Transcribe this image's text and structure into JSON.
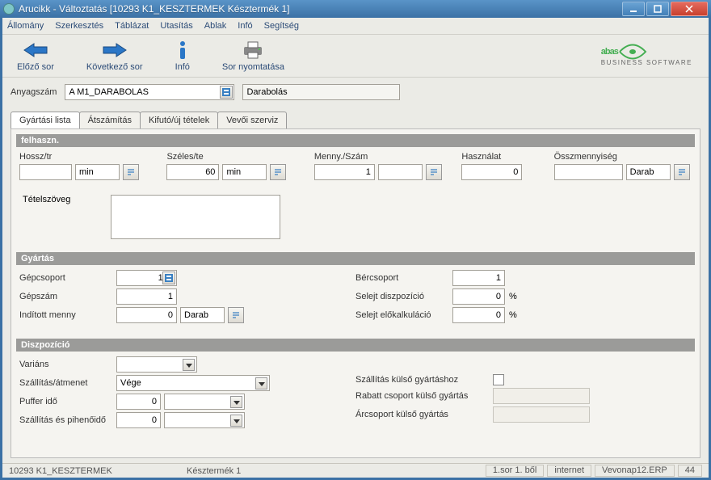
{
  "window": {
    "title": "Arucikk - Változtatás  [10293   K1_KESZTERMEK   Késztermék 1]"
  },
  "menu": {
    "items": [
      "Állomány",
      "Szerkesztés",
      "Táblázat",
      "Utasítás",
      "Ablak",
      "Infó",
      "Segítség"
    ]
  },
  "toolbar": {
    "prev_row": "Előző sor",
    "next_row": "Következő sor",
    "info": "Infó",
    "print_row": "Sor nyomtatása"
  },
  "logo": {
    "name": "abas",
    "subtitle": "BUSINESS SOFTWARE"
  },
  "header_fields": {
    "material_number_label": "Anyagszám",
    "material_number_value": "A M1_DARABOLAS",
    "material_desc": "Darabolás"
  },
  "tabs": {
    "t1": "Gyártási lista",
    "t2": "Átszámítás",
    "t3": "Kifutó/új tételek",
    "t4": "Vevői szerviz"
  },
  "felh": {
    "title": "felhaszn.",
    "hossz_label": "Hossz/tr",
    "hossz_val": "",
    "hossz_unit": "min",
    "szeles_label": "Széles/te",
    "szeles_val": "60",
    "szeles_unit": "min",
    "menny_label": "Menny./Szám",
    "menny_val": "1",
    "hasznalat_label": "Használat",
    "hasznalat_val": "0",
    "ossz_label": "Összmennyiség",
    "ossz_val": "",
    "ossz_unit": "Darab",
    "tetelszoveg_label": "Tételszöveg",
    "tetelszoveg_val": ""
  },
  "gyartas": {
    "title": "Gyártás",
    "gepcsoport_label": "Gépcsoport",
    "gepcsoport_val": "101",
    "gepszam_label": "Gépszám",
    "gepszam_val": "1",
    "inditott_label": "Indított menny",
    "inditott_val": "0",
    "inditott_unit": "Darab",
    "bercsoport_label": "Bércsoport",
    "bercsoport_val": "1",
    "selejt_disp_label": "Selejt diszpozíció",
    "selejt_disp_val": "0",
    "selejt_elok_label": "Selejt előkalkuláció",
    "selejt_elok_val": "0",
    "pct": "%"
  },
  "diszp": {
    "title": "Diszpozíció",
    "varians_label": "Variáns",
    "varians_val": "",
    "szallitas_label": "Szállítás/átmenet",
    "szallitas_val": "Vége",
    "puffer_label": "Puffer idő",
    "puffer_val": "0",
    "pihen_label": "Szállítás és pihenőidő",
    "pihen_val": "0",
    "kulso_gyart_label": "Szállítás külső gyártáshoz",
    "rabatt_label": "Rabatt csoport külső gyártás",
    "arcsoport_label": "Árcsoport külső gyártás"
  },
  "status": {
    "left1": "10293 K1_KESZTERMEK",
    "left2": "Késztermék 1",
    "cursor": "1.sor 1. ből",
    "conn": "internet",
    "user": "Vevonap12.ERP",
    "num": "44"
  }
}
